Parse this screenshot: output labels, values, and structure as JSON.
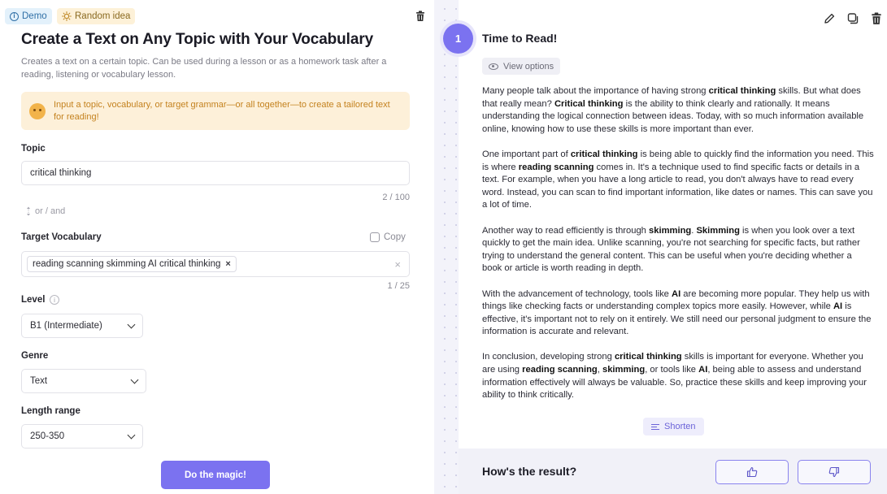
{
  "left": {
    "badges": {
      "demo": "Demo",
      "random": "Random idea"
    },
    "title": "Create a Text on Any Topic with Your Vocabulary",
    "description": "Creates a text on a certain topic. Can be used during a lesson or as a homework task after a reading, listening or vocabulary lesson.",
    "hint": "Input a topic, vocabulary, or target grammar—or all together—to create a tailored text for reading!",
    "topic": {
      "label": "Topic",
      "value": "critical thinking",
      "counter": "2 / 100"
    },
    "or_and": "or / and",
    "vocabulary": {
      "label": "Target Vocabulary",
      "copy": "Copy",
      "chip": "reading scanning skimming AI critical thinking",
      "chip_remove": "×",
      "clear": "×",
      "counter": "1 / 25"
    },
    "level": {
      "label": "Level",
      "info": "i",
      "value": "B1 (Intermediate)"
    },
    "genre": {
      "label": "Genre",
      "value": "Text"
    },
    "length": {
      "label": "Length range",
      "value": "250-350"
    },
    "submit": "Do the magic!"
  },
  "right": {
    "step": "1",
    "title": "Time to Read!",
    "view_options": "View options",
    "shorten": "Shorten",
    "feedback": "How's the result?",
    "paragraphs": [
      [
        {
          "t": "Many people talk about the importance of having strong "
        },
        {
          "t": "critical thinking",
          "b": true
        },
        {
          "t": " skills. But what does that really mean? "
        },
        {
          "t": "Critical thinking",
          "b": true
        },
        {
          "t": " is the ability to think clearly and rationally. It means understanding the logical connection between ideas. Today, with so much information available online, knowing how to use these skills is more important than ever."
        }
      ],
      [
        {
          "t": "One important part of "
        },
        {
          "t": "critical thinking",
          "b": true
        },
        {
          "t": " is being able to quickly find the information you need. This is where "
        },
        {
          "t": "reading scanning",
          "b": true
        },
        {
          "t": " comes in. It's a technique used to find specific facts or details in a text. For example, when you have a long article to read, you don't always have to read every word. Instead, you can scan to find important information, like dates or names. This can save you a lot of time."
        }
      ],
      [
        {
          "t": "Another way to read efficiently is through "
        },
        {
          "t": "skimming",
          "b": true
        },
        {
          "t": ". "
        },
        {
          "t": "Skimming",
          "b": true
        },
        {
          "t": " is when you look over a text quickly to get the main idea. Unlike scanning, you're not searching for specific facts, but rather trying to understand the general content. This can be useful when you're deciding whether a book or article is worth reading in depth."
        }
      ],
      [
        {
          "t": "With the advancement of technology, tools like "
        },
        {
          "t": "AI",
          "b": true
        },
        {
          "t": " are becoming more popular. They help us with things like checking facts or understanding complex topics more easily. However, while "
        },
        {
          "t": "AI",
          "b": true
        },
        {
          "t": " is effective, it's important not to rely on it entirely. We still need our personal judgment to ensure the information is accurate and relevant."
        }
      ],
      [
        {
          "t": "In conclusion, developing strong "
        },
        {
          "t": "critical thinking",
          "b": true
        },
        {
          "t": " skills is important for everyone. Whether you are using "
        },
        {
          "t": "reading scanning",
          "b": true
        },
        {
          "t": ", "
        },
        {
          "t": "skimming",
          "b": true
        },
        {
          "t": ", or tools like "
        },
        {
          "t": "AI",
          "b": true
        },
        {
          "t": ", being able to assess and understand information effectively will always be valuable. So, practice these skills and keep improving your ability to think critically."
        }
      ]
    ]
  },
  "icons": {
    "demo": "info-icon",
    "random": "sun-icon",
    "trash": "trash-icon",
    "pencil": "pencil-icon",
    "copy": "copy-icon",
    "eye": "eye-icon",
    "shorten": "lines-icon",
    "thumb_up": "thumb-up-icon",
    "thumb_down": "thumb-down-icon"
  },
  "colors": {
    "accent": "#7b72f0",
    "hint_bg": "#fdf0d9",
    "hint_text": "#c4821f"
  }
}
